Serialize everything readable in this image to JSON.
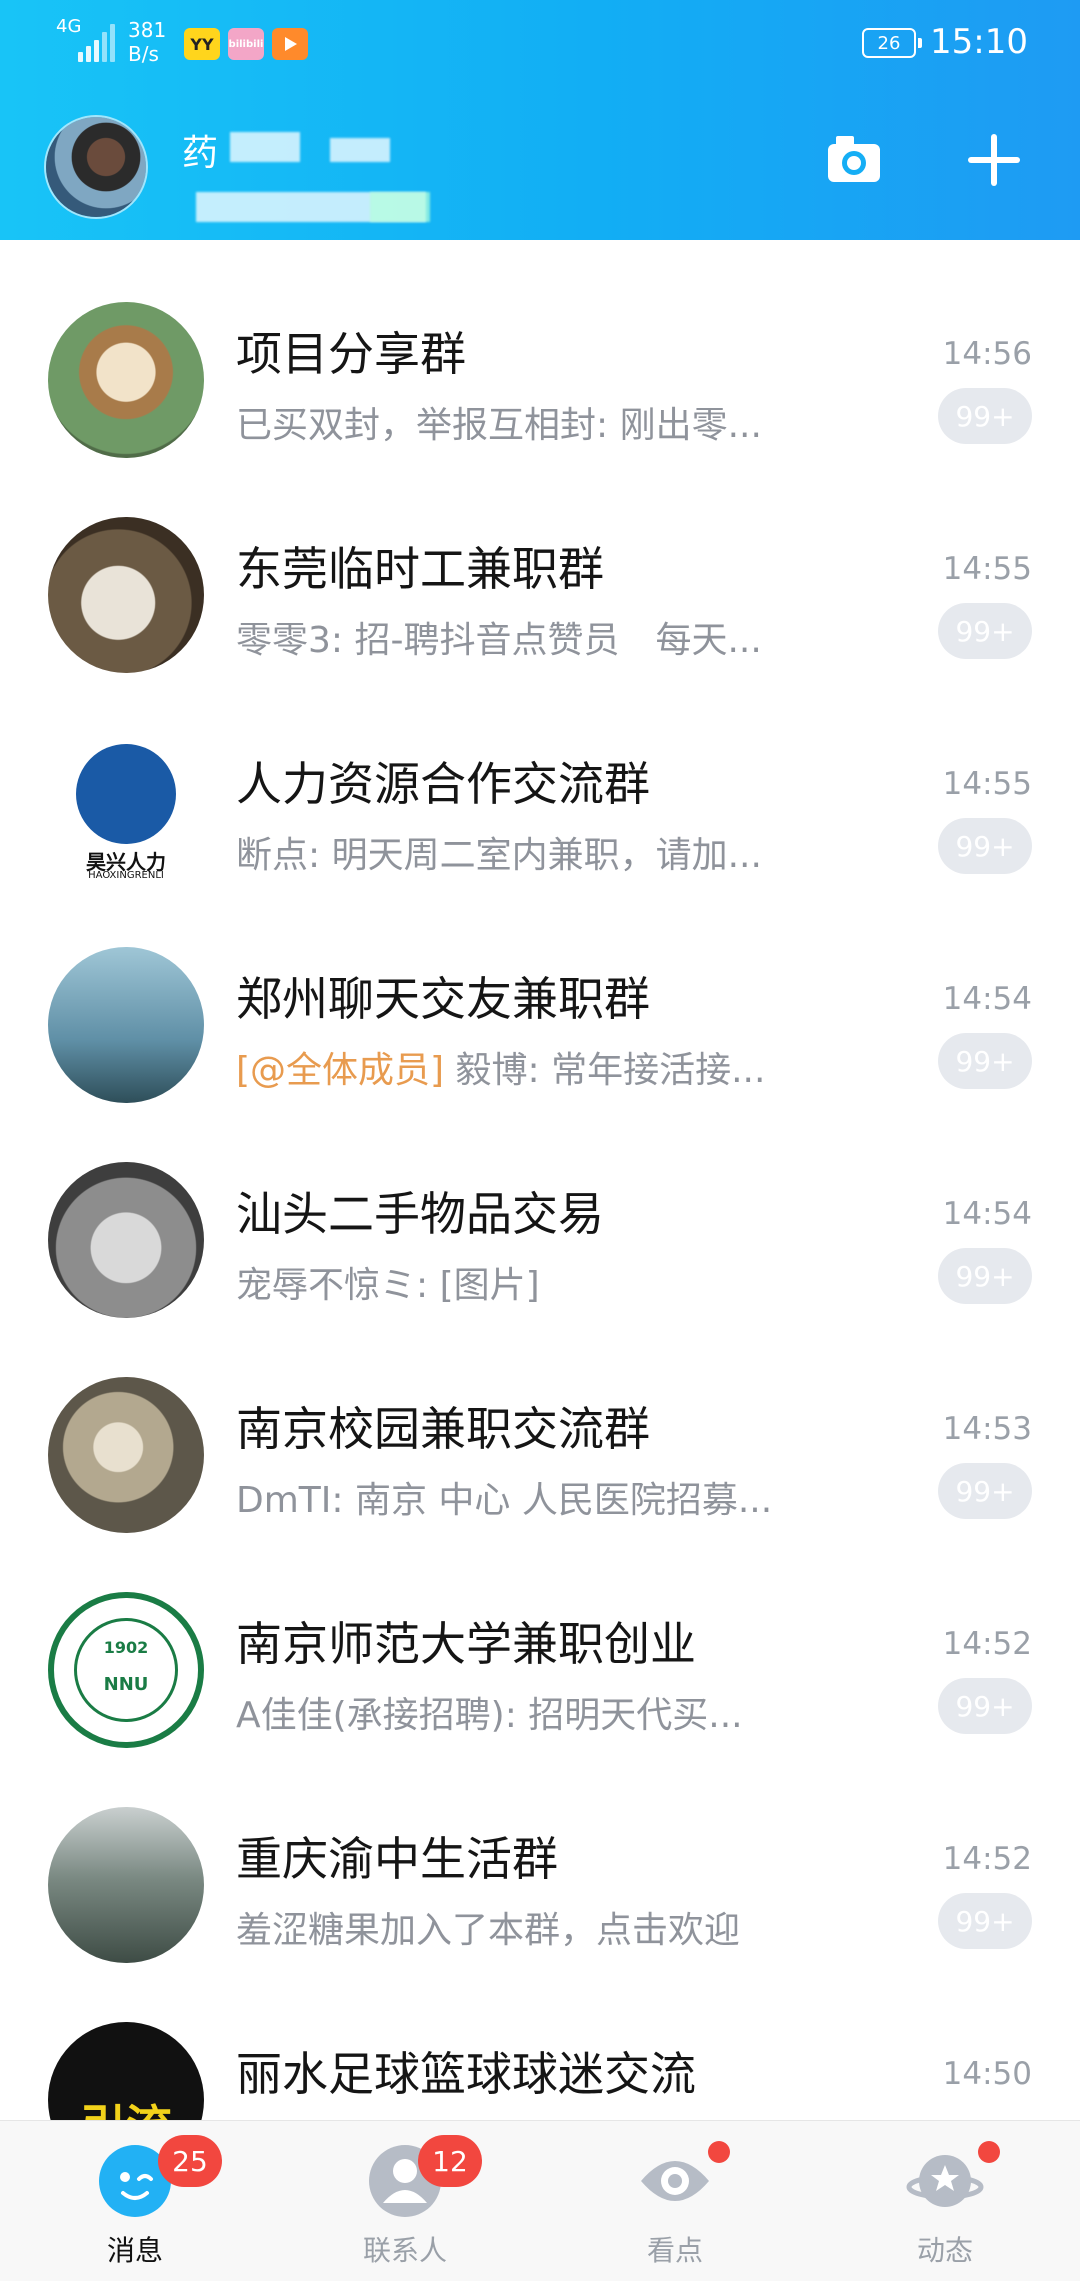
{
  "status_bar": {
    "signal_label": "4G",
    "net_speed": "381",
    "net_unit": "B/s",
    "mini_icons": [
      "YY",
      "bilibili",
      "play"
    ],
    "battery": "26",
    "time": "15:10"
  },
  "header": {
    "username_char": "药"
  },
  "chats": [
    {
      "title": "项目分享群",
      "snippet": "已买双封，举报互相封: 刚出零...",
      "time": "14:56",
      "badge": "99+"
    },
    {
      "title": "东莞临时工兼职群",
      "snippet": "零零3: 招-聘抖音点赞员　每天...",
      "time": "14:55",
      "badge": "99+"
    },
    {
      "title": "人力资源合作交流群",
      "snippet": "断点: 明天周二室内兼职，请加...",
      "time": "14:55",
      "badge": "99+",
      "avatar_text": "昊兴人力",
      "avatar_sub": "HAOXINGRENLI"
    },
    {
      "title": "郑州聊天交友兼职群",
      "mention": "[@全体成员]",
      "snippet": " 毅博: 常年接活接...",
      "time": "14:54",
      "badge": "99+"
    },
    {
      "title": "汕头二手物品交易",
      "snippet": "宠辱不惊ミ: [图片]",
      "time": "14:54",
      "badge": "99+"
    },
    {
      "title": "南京校园兼职交流群",
      "snippet": "DmTI: 南京 中心 人民医院招募...",
      "time": "14:53",
      "badge": "99+"
    },
    {
      "title": "南京师范大学兼职创业",
      "snippet": "A佳佳(承接招聘): 招明天代买...",
      "time": "14:52",
      "badge": "99+",
      "avatar_text": "NNU",
      "avatar_sub": "1902"
    },
    {
      "title": "重庆渝中生活群",
      "snippet": "羞涩糖果加入了本群，点击欢迎",
      "time": "14:52",
      "badge": "99+"
    },
    {
      "title": "丽水足球篮球球迷交流",
      "snippet": "",
      "time": "14:50",
      "badge": "",
      "avatar_text": "引流"
    }
  ],
  "nav": {
    "messages": {
      "label": "消息",
      "badge": "25"
    },
    "contacts": {
      "label": "联系人",
      "badge": "12"
    },
    "watch": {
      "label": "看点"
    },
    "moments": {
      "label": "动态"
    }
  },
  "colors": {
    "accent": "#12aef4",
    "badge_red": "#f2473f",
    "mention": "#e89b4f"
  }
}
